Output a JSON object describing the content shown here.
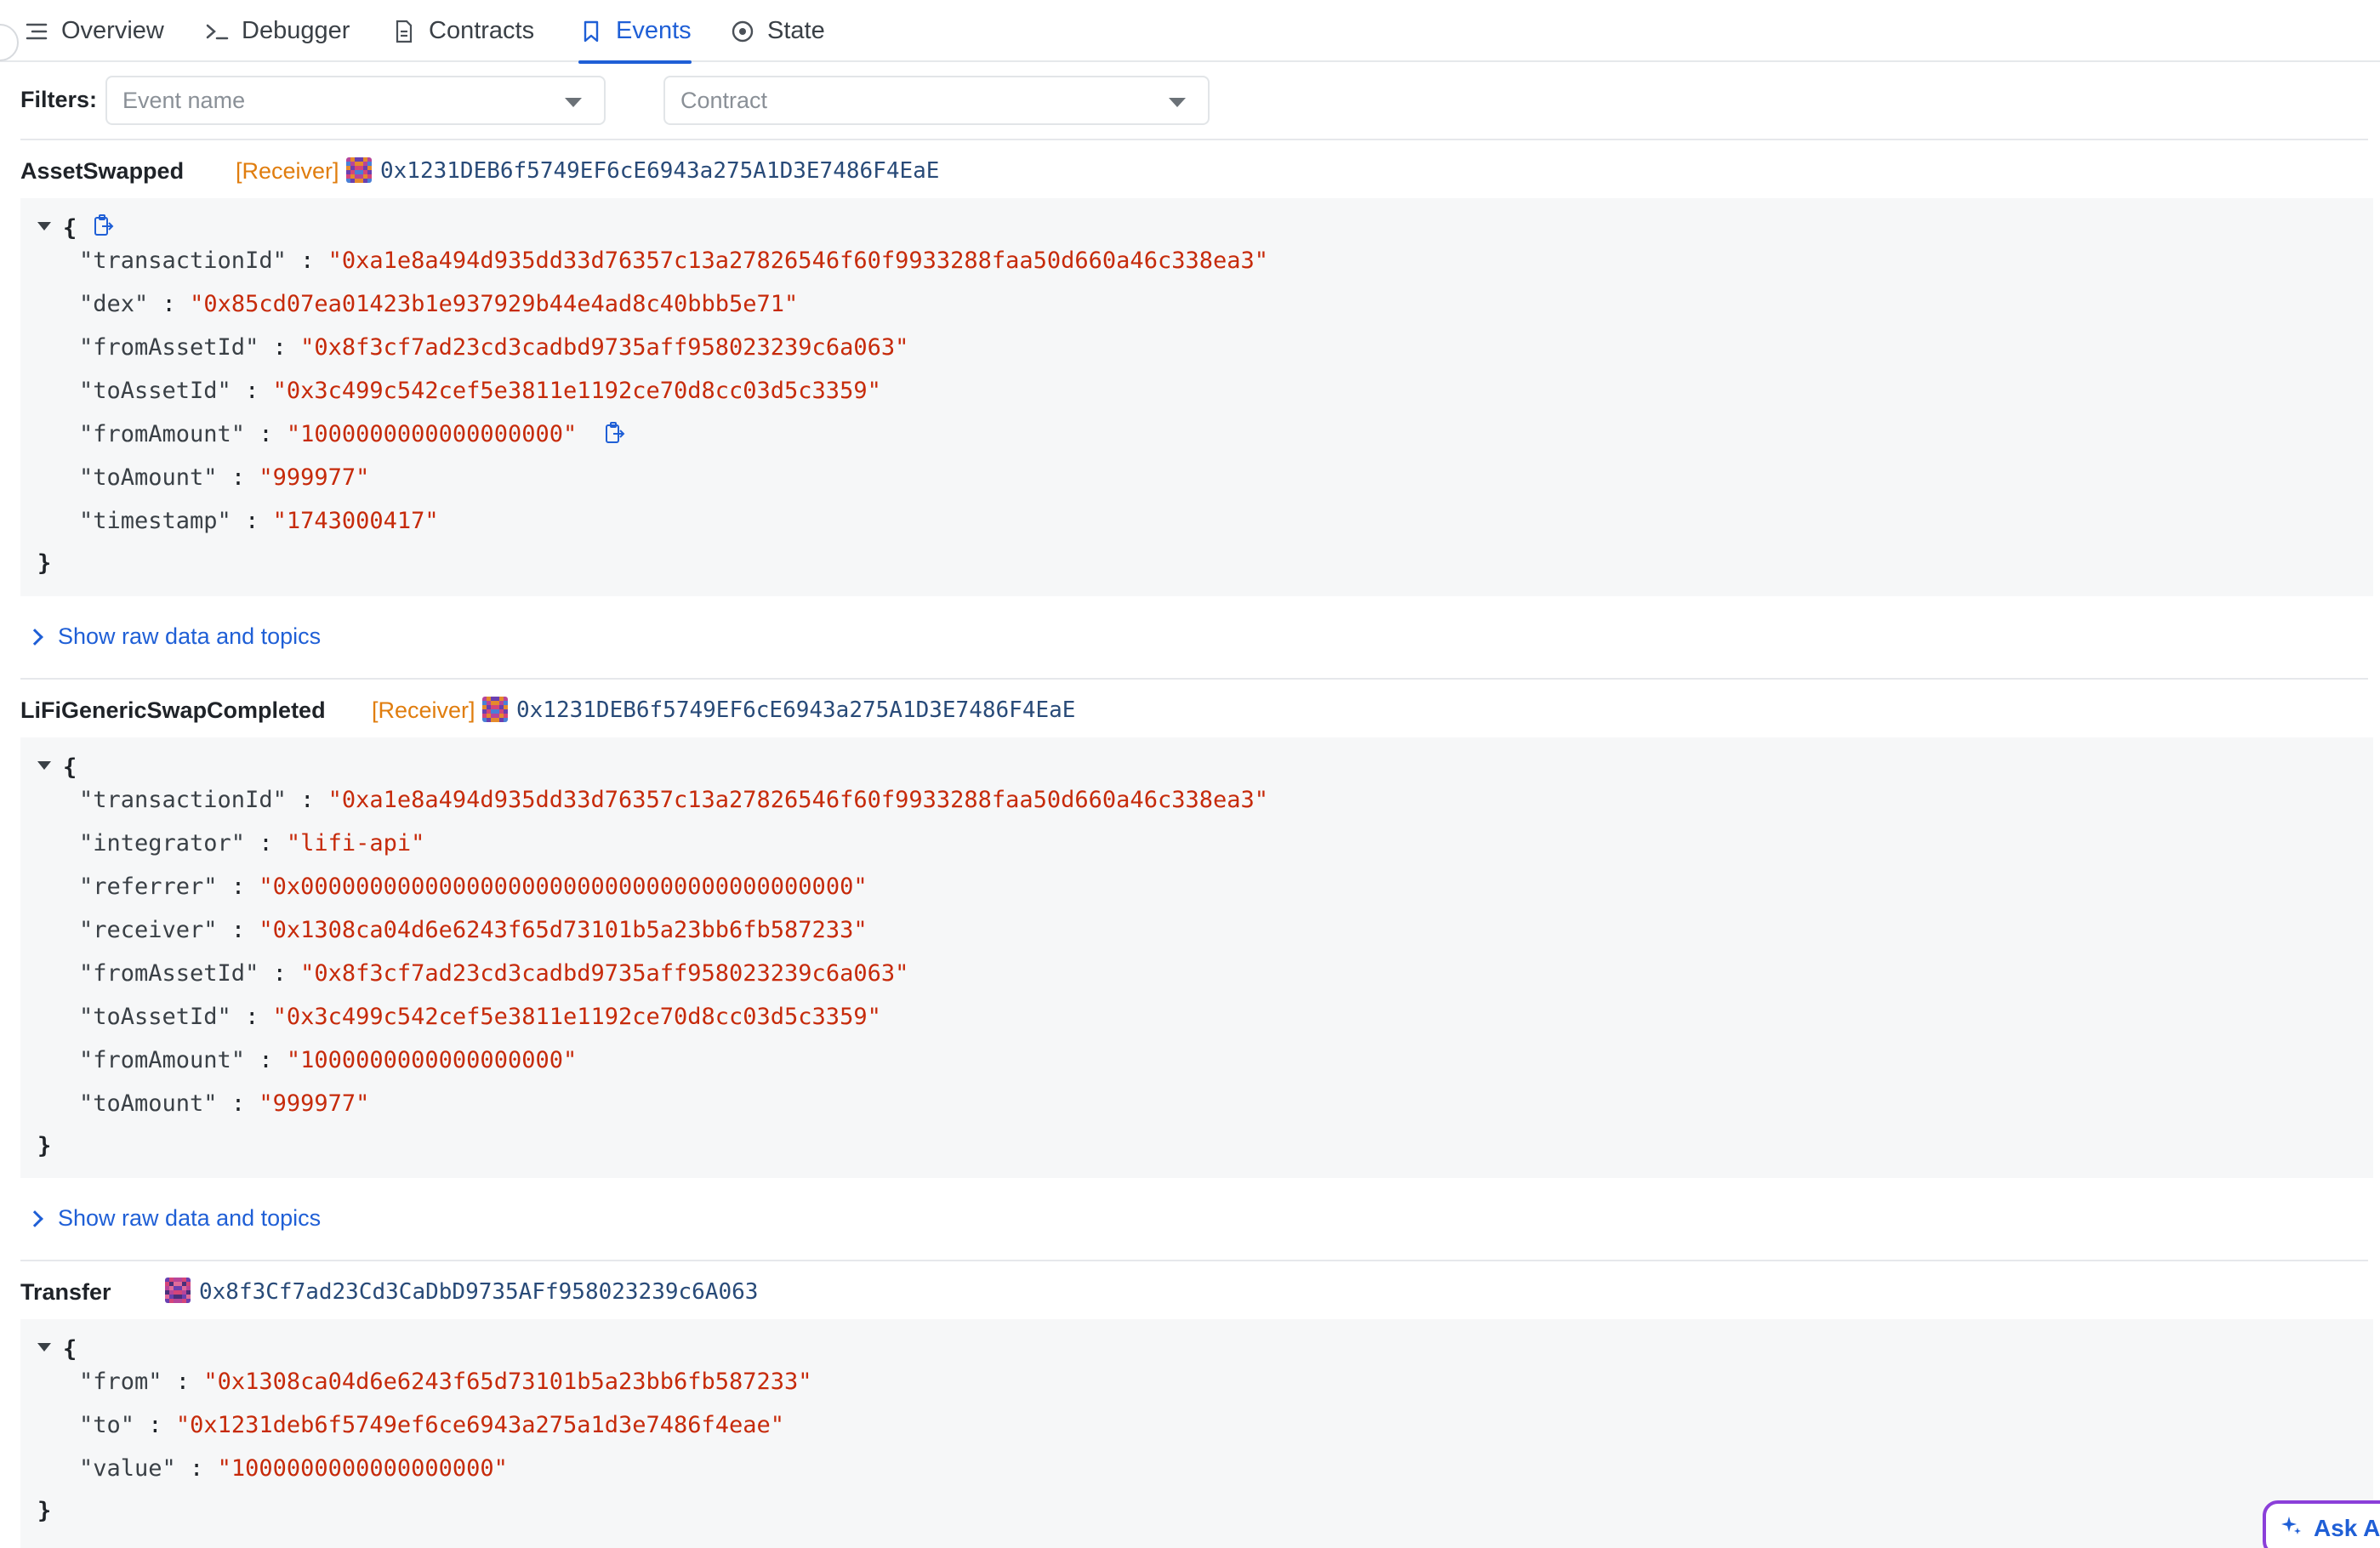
{
  "tabs": [
    {
      "label": "Overview",
      "icon": "list-icon"
    },
    {
      "label": "Debugger",
      "icon": "terminal-icon"
    },
    {
      "label": "Contracts",
      "icon": "document-icon"
    },
    {
      "label": "Events",
      "icon": "bookmark-icon",
      "active": true
    },
    {
      "label": "State",
      "icon": "target-icon"
    }
  ],
  "filters": {
    "label": "Filters:",
    "event_name_placeholder": "Event name",
    "contract_placeholder": "Contract"
  },
  "show_raw_label": "Show raw data and topics",
  "events": [
    {
      "name": "AssetSwapped",
      "tag": "[Receiver]",
      "address": "0x1231DEB6f5749EF6cE6943a275A1D3E7486F4EaE",
      "fields": [
        {
          "key": "\"transactionId\"",
          "value": "\"0xa1e8a494d935dd33d76357c13a27826546f60f9933288faa50d660a46c338ea3\""
        },
        {
          "key": "\"dex\"",
          "value": "\"0x85cd07ea01423b1e937929b44e4ad8c40bbb5e71\""
        },
        {
          "key": "\"fromAssetId\"",
          "value": "\"0x8f3cf7ad23cd3cadbd9735aff958023239c6a063\""
        },
        {
          "key": "\"toAssetId\"",
          "value": "\"0x3c499c542cef5e3811e1192ce70d8cc03d5c3359\""
        },
        {
          "key": "\"fromAmount\"",
          "value": "\"1000000000000000000\""
        },
        {
          "key": "\"toAmount\"",
          "value": "\"999977\""
        },
        {
          "key": "\"timestamp\"",
          "value": "\"1743000417\""
        }
      ]
    },
    {
      "name": "LiFiGenericSwapCompleted",
      "tag": "[Receiver]",
      "address": "0x1231DEB6f5749EF6cE6943a275A1D3E7486F4EaE",
      "fields": [
        {
          "key": "\"transactionId\"",
          "value": "\"0xa1e8a494d935dd33d76357c13a27826546f60f9933288faa50d660a46c338ea3\""
        },
        {
          "key": "\"integrator\"",
          "value": "\"lifi-api\""
        },
        {
          "key": "\"referrer\"",
          "value": "\"0x0000000000000000000000000000000000000000\""
        },
        {
          "key": "\"receiver\"",
          "value": "\"0x1308ca04d6e6243f65d73101b5a23bb6fb587233\""
        },
        {
          "key": "\"fromAssetId\"",
          "value": "\"0x8f3cf7ad23cd3cadbd9735aff958023239c6a063\""
        },
        {
          "key": "\"toAssetId\"",
          "value": "\"0x3c499c542cef5e3811e1192ce70d8cc03d5c3359\""
        },
        {
          "key": "\"fromAmount\"",
          "value": "\"1000000000000000000\""
        },
        {
          "key": "\"toAmount\"",
          "value": "\"999977\""
        }
      ]
    },
    {
      "name": "Transfer",
      "tag": "",
      "address": "0x8f3Cf7ad23Cd3CaDbD9735AFf958023239c6A063",
      "fields": [
        {
          "key": "\"from\"",
          "value": "\"0x1308ca04d6e6243f65d73101b5a23bb6fb587233\""
        },
        {
          "key": "\"to\"",
          "value": "\"0x1231deb6f5749ef6ce6943a275a1d3e7486f4eae\""
        },
        {
          "key": "\"value\"",
          "value": "\"1000000000000000000\""
        }
      ]
    }
  ],
  "json_open": "{",
  "json_close": "}",
  "ask_ai_label": "Ask AI"
}
